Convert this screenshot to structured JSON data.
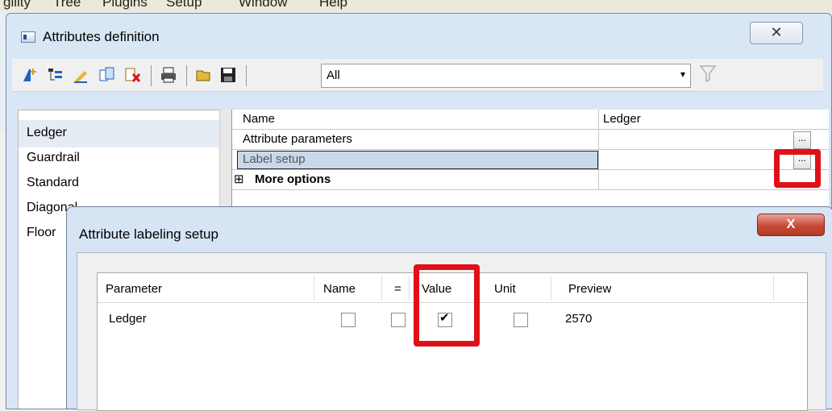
{
  "menubar": {
    "items": [
      "gility",
      "Tree",
      "Plugins",
      "Setup",
      "Window",
      "Help"
    ]
  },
  "outer_dialog": {
    "title": "Attributes definition",
    "close_glyph": "✕",
    "toolbar": {
      "icons": [
        "add-attribute-icon",
        "tree-icon",
        "edit-icon",
        "copy-icon",
        "delete-icon",
        "print-icon",
        "open-folder-icon",
        "save-icon"
      ],
      "filter_combo_value": "All",
      "combo_arrow": "▾",
      "filter_icon": "funnel-icon"
    },
    "object_list": [
      "Ledger",
      "Guardrail",
      "Standard",
      "Diagonal",
      "Floor"
    ],
    "properties": {
      "header": {
        "col1": "Name",
        "col2": "Ledger"
      },
      "rows": [
        {
          "label": "Attribute parameters",
          "value": "",
          "button": "..."
        },
        {
          "label": "Label setup",
          "value": "",
          "button": "..."
        },
        {
          "label": "More options",
          "expander": "⊞"
        }
      ]
    }
  },
  "inner_dialog": {
    "title": "Attribute labeling setup",
    "close_glyph": "X",
    "columns": [
      "Parameter",
      "Name",
      "=",
      "Value",
      "Unit",
      "Preview"
    ],
    "rows": [
      {
        "parameter": "Ledger",
        "name": false,
        "equals": false,
        "value": true,
        "unit": false,
        "preview": "2570"
      }
    ]
  },
  "colors": {
    "highlight": "#e01018",
    "selection": "#c9d9ec"
  }
}
